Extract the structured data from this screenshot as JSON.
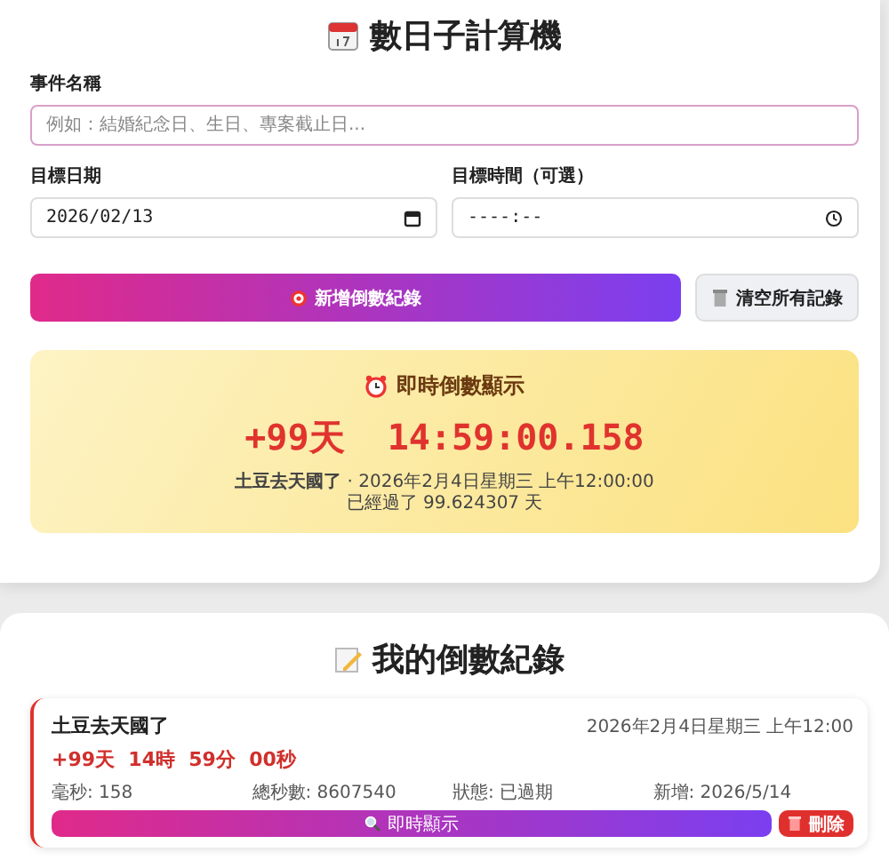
{
  "title": "數日子計算機",
  "form": {
    "event_name": {
      "label": "事件名稱",
      "placeholder": "例如：結婚紀念日、生日、專案截止日..."
    },
    "target_date": {
      "label": "目標日期",
      "value": "2026/02/13"
    },
    "target_time": {
      "label": "目標時間（可選）",
      "value": "----:--"
    }
  },
  "buttons": {
    "add": "新增倒數紀錄",
    "clear": "清空所有記錄"
  },
  "live": {
    "title": "即時倒數顯示",
    "countdown": "+99天  14:59:00.158",
    "event": "土豆去天國了",
    "date": "· 2026年2月4日星期三 上午12:00:00",
    "elapsed": "已經過了 99.624307 天"
  },
  "records": {
    "title": "我的倒數紀錄",
    "items": [
      {
        "name": "土豆去天國了",
        "date": "2026年2月4日星期三 上午12:00",
        "countdown": "+99天  14時  59分  00秒",
        "stats": [
          "毫秒: 158",
          "總秒數: 8607540",
          "狀態: 已過期",
          "新增: 2026/5/14"
        ],
        "show_button": "即時顯示",
        "delete_button": "刪除",
        "expired": true
      }
    ]
  }
}
